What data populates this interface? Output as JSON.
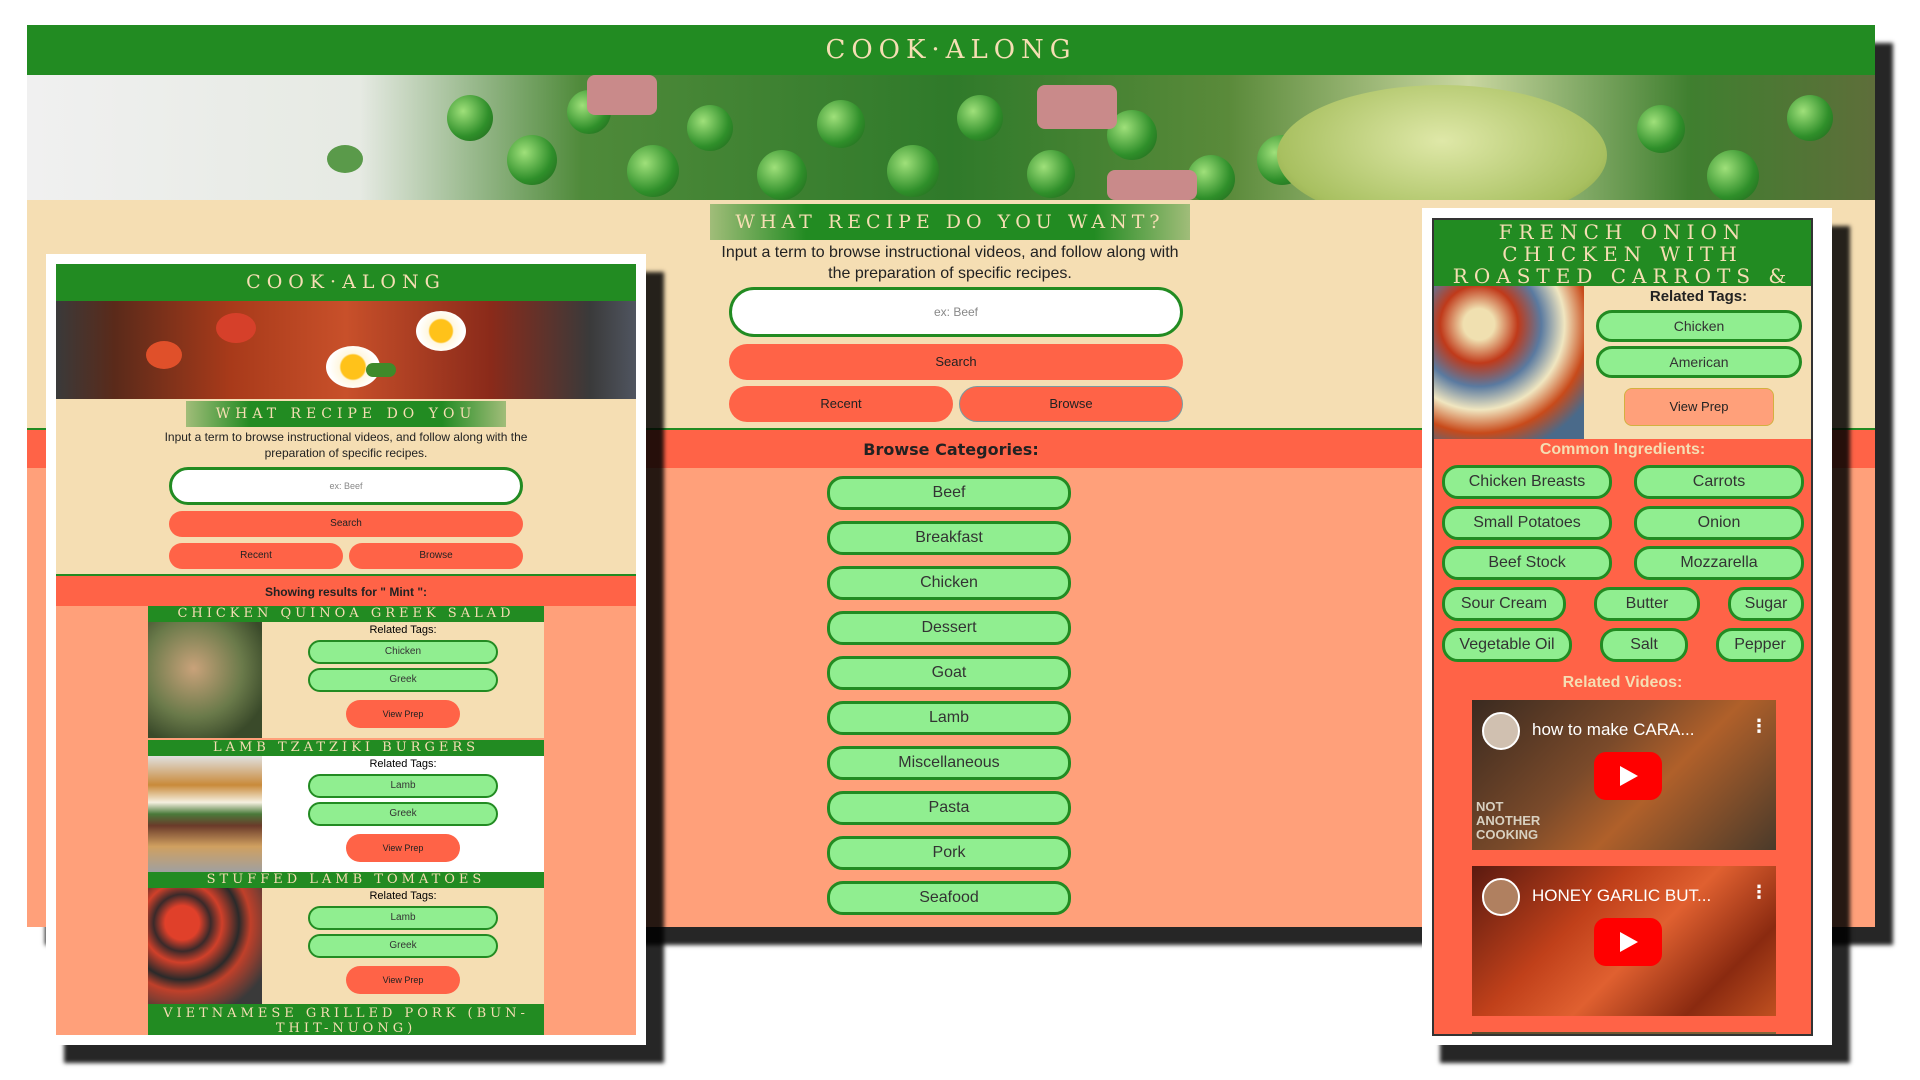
{
  "main": {
    "title": "COOK·ALONG",
    "prompt_heading": "WHAT RECIPE DO YOU WANT?",
    "prompt_text": "Input a term to browse instructional videos, and follow along with the preparation of specific recipes.",
    "search_placeholder": "ex: Beef",
    "search_label": "Search",
    "recent_label": "Recent",
    "browse_label": "Browse",
    "browse_heading": "Browse Categories:",
    "categories": [
      "Beef",
      "Breakfast",
      "Chicken",
      "Dessert",
      "Goat",
      "Lamb",
      "Miscellaneous",
      "Pasta",
      "Pork",
      "Seafood"
    ]
  },
  "left": {
    "title": "COOK·ALONG",
    "prompt_heading": "WHAT RECIPE DO YOU WANT?",
    "prompt_text": "Input a term to browse instructional videos, and follow along with the preparation of specific recipes.",
    "search_placeholder": "ex: Beef",
    "search_label": "Search",
    "recent_label": "Recent",
    "browse_label": "Browse",
    "results_heading": "Showing results for \" Mint \":",
    "related_label": "Related Tags:",
    "view_prep": "View Prep",
    "results": [
      {
        "title": "CHICKEN QUINOA GREEK SALAD",
        "tags": [
          "Chicken",
          "Greek"
        ]
      },
      {
        "title": "LAMB TZATZIKI BURGERS",
        "tags": [
          "Lamb",
          "Greek"
        ]
      },
      {
        "title": "STUFFED LAMB TOMATOES",
        "tags": [
          "Lamb",
          "Greek"
        ]
      },
      {
        "title": "VIETNAMESE GRILLED PORK (BUN-THIT-NUONG)",
        "tags": []
      }
    ]
  },
  "right": {
    "recipe_title": "FRENCH ONION CHICKEN WITH ROASTED CARROTS & MASHED POTATOES",
    "related_label": "Related Tags:",
    "tags": [
      "Chicken",
      "American"
    ],
    "view_prep": "View Prep",
    "ingredients_heading": "Common Ingredients:",
    "ingredients": [
      "Chicken Breasts",
      "Carrots",
      "Small Potatoes",
      "Onion",
      "Beef Stock",
      "Mozzarella",
      "Sour Cream",
      "Butter",
      "Sugar",
      "Vegetable Oil",
      "Salt",
      "Pepper"
    ],
    "videos_heading": "Related Videos:",
    "videos": [
      {
        "title": "how to make CARA...",
        "overlay_text": "NOT ANOTHER COOKING"
      },
      {
        "title": "HONEY GARLIC BUT...",
        "overlay_text": ""
      }
    ]
  },
  "colors": {
    "green": "#228b22",
    "wheat": "#f5deb3",
    "tomato": "#ff6347",
    "salmon": "#ffa07a",
    "light_green": "#90ee90"
  }
}
